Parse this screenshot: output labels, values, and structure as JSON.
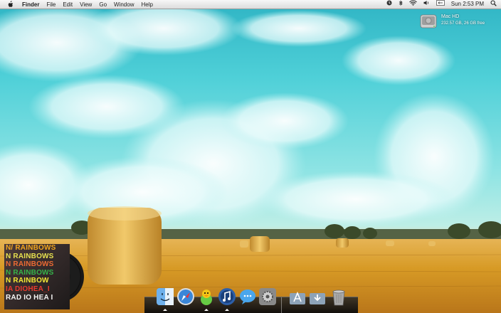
{
  "menubar": {
    "apple_icon": "apple-logo-icon",
    "app_name": "Finder",
    "menus": [
      "File",
      "Edit",
      "View",
      "Go",
      "Window",
      "Help"
    ],
    "status_icons": [
      "timemachine-icon",
      "bluetooth-icon",
      "wifi-icon",
      "volume-icon",
      "input-menu-icon"
    ],
    "clock": "Sun 2:53 PM",
    "search_icon": "spotlight-search-icon"
  },
  "desktop": {
    "drive": {
      "name": "Mac HD",
      "capacity": "232.57 GB, 26 GB free",
      "icon": "hard-drive-icon"
    }
  },
  "album_widget": {
    "lines": [
      {
        "text": "N/ RAINBOWS",
        "color": "#f2a51d"
      },
      {
        "text": "N RAINBOWS",
        "color": "#e7e14f"
      },
      {
        "text": "N RAINBOWS",
        "color": "#ec6a33"
      },
      {
        "text": "N RAINBOWS",
        "color": "#35b34a"
      },
      {
        "text": "N RAINBOW",
        "color": "#f3ea36"
      },
      {
        "text": "IA DIOHEA_I",
        "color": "#ea3a2e"
      },
      {
        "text": "RAD IO HEA I",
        "color": "#f5f5f5"
      }
    ]
  },
  "dock": {
    "items": [
      {
        "name": "finder",
        "icon": "finder-icon",
        "running": true
      },
      {
        "name": "safari",
        "icon": "safari-icon",
        "running": false
      },
      {
        "name": "adium",
        "icon": "adium-duck-icon",
        "running": true
      },
      {
        "name": "itunes",
        "icon": "itunes-icon",
        "running": true
      },
      {
        "name": "ichat",
        "icon": "ichat-icon",
        "running": false
      },
      {
        "name": "system-preferences",
        "icon": "system-preferences-icon",
        "running": false
      },
      {
        "name": "applications-stack",
        "icon": "applications-folder-icon",
        "running": false
      },
      {
        "name": "downloads-stack",
        "icon": "downloads-folder-icon",
        "running": false
      },
      {
        "name": "trash",
        "icon": "trash-icon",
        "running": false
      }
    ]
  },
  "colors": {
    "sky": "#2fb4c4",
    "field": "#d59a2a",
    "menubar": "#e6e6e6"
  }
}
